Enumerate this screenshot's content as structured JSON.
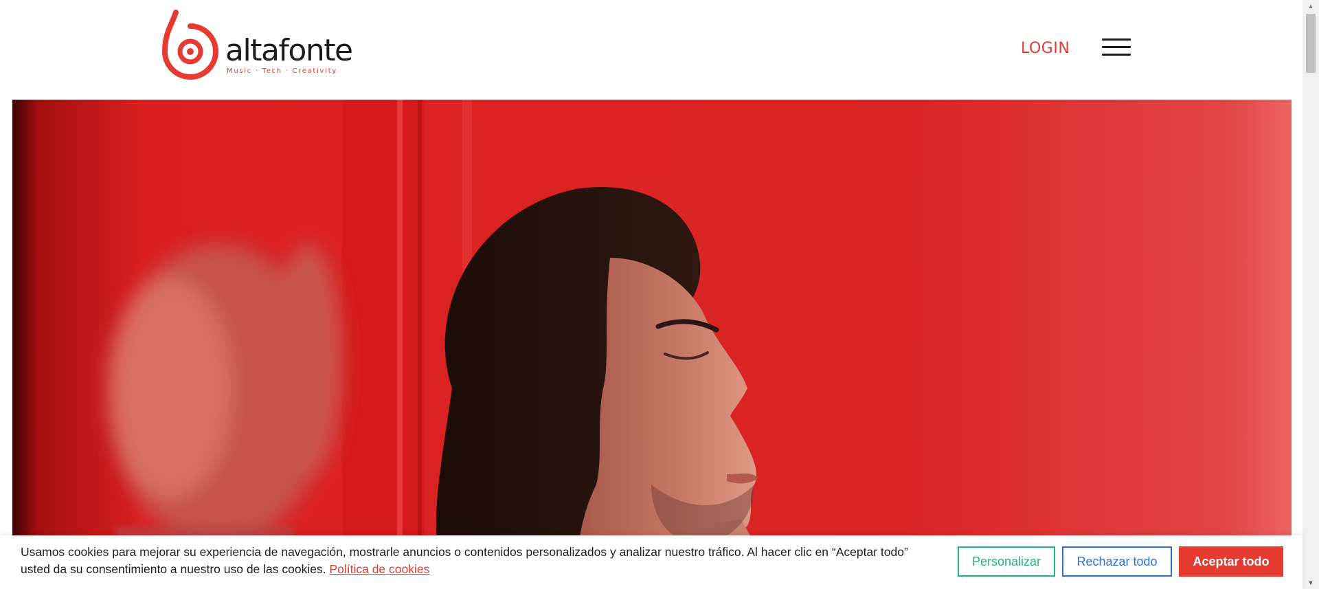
{
  "header": {
    "logo_word": "altafonte",
    "logo_tagline": "Music · Tech · Creativity",
    "login_label": "LOGIN"
  },
  "hero": {
    "image": "Man with long dark hair, eyes closed, head tilted back against a red wall with a blurred reflection"
  },
  "cookie_banner": {
    "text": "Usamos cookies para mejorar su experiencia de navegación, mostrarle anuncios o contenidos personalizados y analizar nuestro tráfico. Al hacer clic en “Aceptar todo” usted da su consentimiento a nuestro uso de las cookies.",
    "policy_link": "Política de cookies",
    "buttons": {
      "customize": "Personalizar",
      "reject": "Rechazar todo",
      "accept": "Aceptar todo"
    }
  },
  "colors": {
    "brand_red": "#e53b30",
    "customize_green": "#1db67f",
    "reject_blue": "#2f6fd8"
  },
  "icons": [
    "logo-mark-icon",
    "hamburger-menu-icon",
    "scroll-up-arrow-icon",
    "scroll-down-arrow-icon"
  ]
}
